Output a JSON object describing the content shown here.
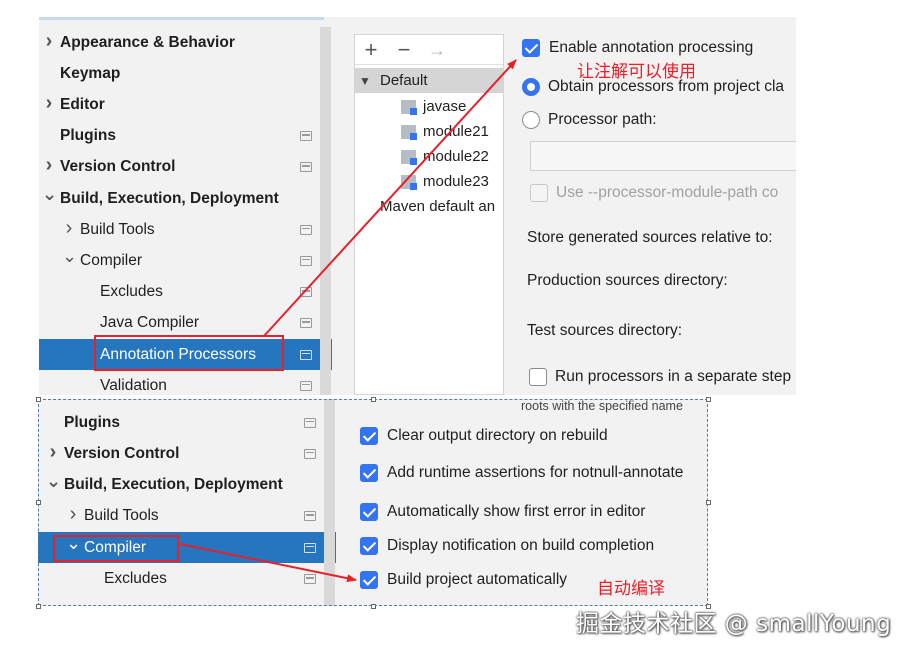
{
  "top_sidebar": {
    "items": [
      {
        "label": "Appearance & Behavior",
        "bold": true,
        "chevron": "right"
      },
      {
        "label": "Keymap",
        "bold": true,
        "chevron": ""
      },
      {
        "label": "Editor",
        "bold": true,
        "chevron": "right"
      },
      {
        "label": "Plugins",
        "bold": true,
        "chevron": ""
      },
      {
        "label": "Version Control",
        "bold": true,
        "chevron": "right"
      },
      {
        "label": "Build, Execution, Deployment",
        "bold": true,
        "chevron": "down"
      },
      {
        "label": "Build Tools",
        "bold": false,
        "chevron": "right"
      },
      {
        "label": "Compiler",
        "bold": false,
        "chevron": "down"
      },
      {
        "label": "Excludes",
        "bold": false,
        "chevron": ""
      },
      {
        "label": "Java Compiler",
        "bold": false,
        "chevron": ""
      },
      {
        "label": "Annotation Processors",
        "bold": false,
        "chevron": ""
      },
      {
        "label": "Validation",
        "bold": false,
        "chevron": ""
      }
    ]
  },
  "profiles": {
    "toolbar": {
      "add": "+",
      "remove": "−",
      "move": "→"
    },
    "default_label": "Default",
    "modules": [
      "javase",
      "module21",
      "module22",
      "module23"
    ],
    "maven_label": "Maven default an"
  },
  "annotation_settings": {
    "enable_label": "Enable annotation processing",
    "obtain_label": "Obtain processors from project cla",
    "processor_path_label": "Processor path:",
    "module_path_label": "Use --processor-module-path co",
    "store_label": "Store generated sources relative to:",
    "production_label": "Production sources directory:",
    "test_label": "Test sources directory:",
    "run_separate_label": "Run processors in a separate step"
  },
  "bottom_sidebar": {
    "items": [
      {
        "label": "Plugins",
        "bold": true,
        "chevron": ""
      },
      {
        "label": "Version Control",
        "bold": true,
        "chevron": "right"
      },
      {
        "label": "Build, Execution, Deployment",
        "bold": true,
        "chevron": "down"
      },
      {
        "label": "Build Tools",
        "bold": false,
        "chevron": "right"
      },
      {
        "label": "Compiler",
        "bold": false,
        "chevron": "down"
      },
      {
        "label": "Excludes",
        "bold": false,
        "chevron": ""
      }
    ]
  },
  "compiler_settings": {
    "roots_text": "roots with the specified name",
    "clear_output_label": "Clear output directory on rebuild",
    "runtime_assertions_label": "Add runtime assertions for notnull-annotate",
    "show_error_label": "Automatically show first error in editor",
    "notification_label": "Display notification on build completion",
    "build_auto_label": "Build project automatically"
  },
  "annotations": {
    "top_note": "让注解可以使用",
    "bottom_note": "自动编译",
    "color": "#e8202a"
  },
  "watermark": "掘金技术社区 @ smallYoung",
  "colors": {
    "accent": "#3574f0",
    "selection": "#2675bf",
    "panel": "#f2f2f2"
  }
}
